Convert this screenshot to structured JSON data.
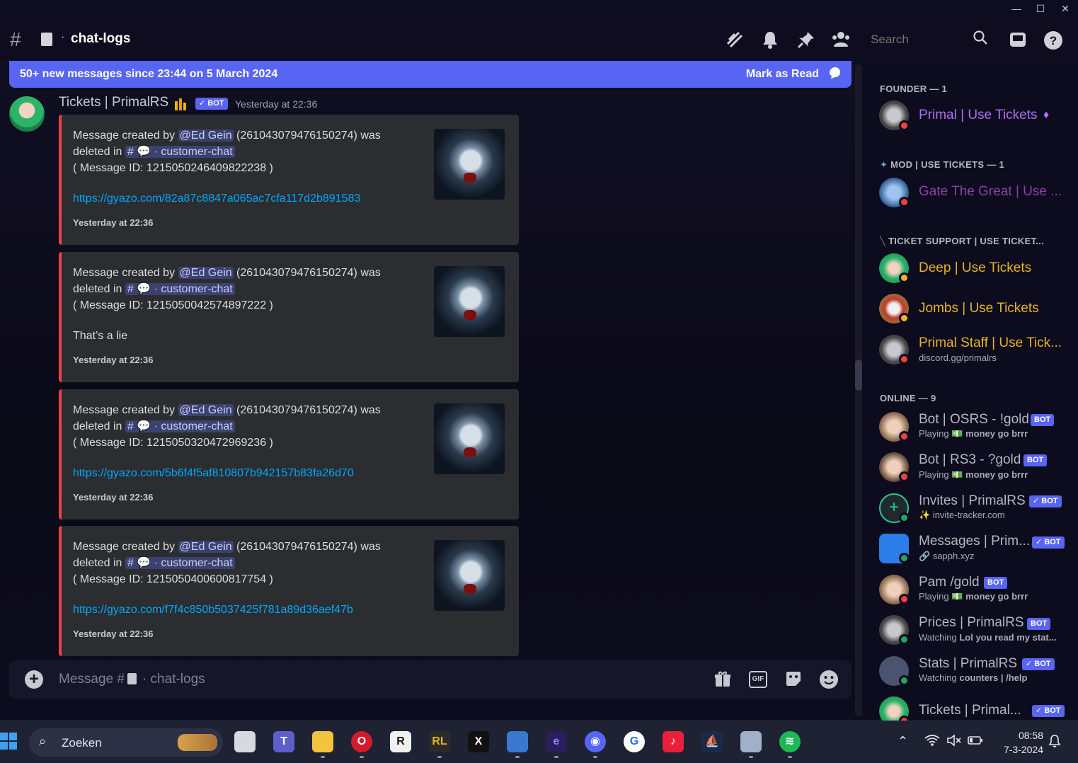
{
  "window": {
    "minimize": "—",
    "maximize": "☐",
    "close": "✕"
  },
  "header": {
    "channel_prefix": "·",
    "channel_name": "chat-logs",
    "search_placeholder": "Search",
    "icons": [
      "threads-icon",
      "bell-icon",
      "pin-icon",
      "members-icon",
      "search-icon",
      "inbox-icon",
      "help-icon"
    ]
  },
  "banner": {
    "text": "50+ new messages since 23:44 on 5 March 2024",
    "action": "Mark as Read"
  },
  "message": {
    "author": "Tickets | PrimalRS",
    "bot_tag": "BOT",
    "timestamp": "Yesterday at 22:36"
  },
  "embeds": [
    {
      "prefix": "Message created by",
      "mention": "@Ed Gein",
      "user_id": "(261043079476150274) was",
      "deleted_in": "deleted in",
      "channel": "· customer-chat",
      "message_id": "( Message ID: 1215050246409822238 )",
      "content": "https://gyazo.com/82a87c8847a065ac7cfa117d2b891583",
      "is_link": true,
      "footer": "Yesterday at 22:36"
    },
    {
      "prefix": "Message created by",
      "mention": "@Ed Gein",
      "user_id": "(261043079476150274) was",
      "deleted_in": "deleted in",
      "channel": "· customer-chat",
      "message_id": "( Message ID: 1215050042574897222 )",
      "content": "That’s a lie",
      "is_link": false,
      "footer": "Yesterday at 22:36"
    },
    {
      "prefix": "Message created by",
      "mention": "@Ed Gein",
      "user_id": "(261043079476150274) was",
      "deleted_in": "deleted in",
      "channel": "· customer-chat",
      "message_id": "( Message ID: 1215050320472969236 )",
      "content": "https://gyazo.com/5b6f4f5af810807b942157b83fa26d70",
      "is_link": true,
      "footer": "Yesterday at 22:36"
    },
    {
      "prefix": "Message created by",
      "mention": "@Ed Gein",
      "user_id": "(261043079476150274) was",
      "deleted_in": "deleted in",
      "channel": "· customer-chat",
      "message_id": "( Message ID: 1215050400600817754 )",
      "content": "https://gyazo.com/f7f4c850b5037425f781a89d36aef47b",
      "is_link": true,
      "footer": "Yesterday at 22:36"
    }
  ],
  "composer": {
    "placeholder_prefix": "Message #",
    "placeholder_channel": "· chat-logs",
    "gif": "GIF"
  },
  "members": {
    "groups": [
      {
        "heading": "FOUNDER — 1",
        "members": [
          {
            "name": "Primal | Use Tickets",
            "color": "#b16cf5",
            "status": "dnd",
            "badge": "gem"
          }
        ]
      },
      {
        "heading": "MOD | USE TICKETS — 1",
        "members": [
          {
            "name": "Gate The Great | Use ...",
            "color": "#8e3fa8",
            "status": "dnd"
          }
        ]
      },
      {
        "heading": "TICKET SUPPORT | USE TICKET...",
        "members": [
          {
            "name": "Deep | Use Tickets",
            "color": "#e6b422",
            "status": "idle"
          },
          {
            "name": "Jombs | Use Tickets",
            "color": "#e6b422",
            "status": "idle"
          },
          {
            "name": "Primal Staff | Use Tick...",
            "color": "#e6b422",
            "status": "dnd",
            "sub": "discord.gg/primalrs"
          }
        ]
      },
      {
        "heading": "ONLINE — 9",
        "members": [
          {
            "name": "Bot | OSRS - !gold",
            "color": "#b5b7be",
            "status": "dnd",
            "bot": "BOT",
            "sub_prefix": "Playing",
            "sub": "money go brrr"
          },
          {
            "name": "Bot | RS3 - ?gold",
            "color": "#b5b7be",
            "status": "dnd",
            "bot": "BOT",
            "sub_prefix": "Playing",
            "sub": "money go brrr"
          },
          {
            "name": "Invites | PrimalRS",
            "color": "#b5b7be",
            "status": "online",
            "bot": "✓ BOT",
            "sub": "invite-tracker.com"
          },
          {
            "name": "Messages | Prim...",
            "color": "#b5b7be",
            "status": "online",
            "bot": "✓ BOT",
            "sub": "sapph.xyz"
          },
          {
            "name": "Pam /gold",
            "color": "#b5b7be",
            "status": "dnd",
            "bot": "BOT",
            "sub_prefix": "Playing",
            "sub": "money go brrr"
          },
          {
            "name": "Prices | PrimalRS",
            "color": "#b5b7be",
            "status": "online",
            "bot": "BOT",
            "sub_prefix": "Watching",
            "sub": "Lol you read my stat..."
          },
          {
            "name": "Stats | PrimalRS",
            "color": "#b5b7be",
            "status": "online",
            "bot": "✓ BOT",
            "sub_prefix": "Watching",
            "sub": "counters | /help"
          },
          {
            "name": "Tickets | Primal...",
            "color": "#b5b7be",
            "status": "dnd",
            "bot": "✓ BOT"
          }
        ]
      }
    ],
    "status_colors": {
      "online": "#23a55a",
      "dnd": "#f23f43",
      "idle": "#f0b232"
    }
  },
  "taskbar": {
    "search_label": "Zoeken",
    "apps": [
      "task-view",
      "teams",
      "file-explorer",
      "opera",
      "roblox",
      "runelite",
      "x",
      "remote-desktop",
      "app-8",
      "discord",
      "app-10",
      "tiktok",
      "app-12",
      "calculator",
      "spotify"
    ],
    "time": "08:58",
    "date": "7-3-2024"
  }
}
